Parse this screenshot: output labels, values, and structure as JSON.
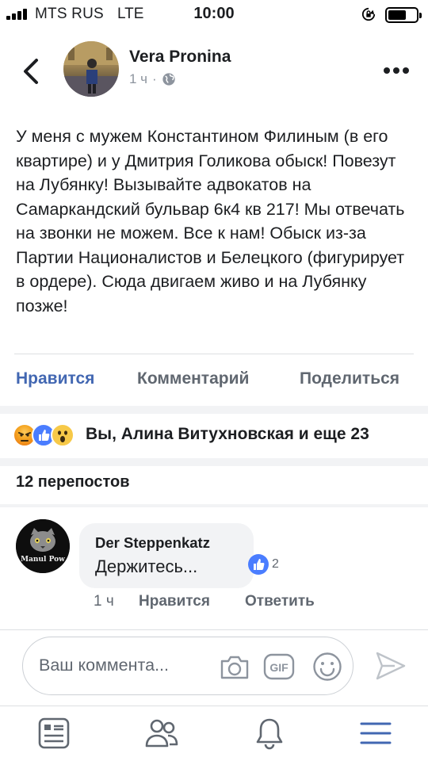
{
  "status_bar": {
    "carrier": "MTS RUS",
    "network": "LTE",
    "time": "10:00"
  },
  "post": {
    "author": "Vera Pronina",
    "time": "1 ч",
    "separator": "·",
    "text": "У меня с мужем Константином Филиным (в его квартире) и у Дмитрия Голикова обыск! Повезут на Лубянку! Вызывайте адвокатов на Самаркандский бульвар 6к4 кв 217! Мы отвечать на звонки не можем. Все к нам! Обыск из-за Партии Националистов и Белецкого (фигурирует в ордере). Сюда двигаем живо и на Лубянку позже!"
  },
  "actions": {
    "like": "Нравится",
    "comment": "Комментарий",
    "share": "Поделиться"
  },
  "reactions": {
    "summary": "Вы, Алина Витухновская и еще 23",
    "icons": [
      "angry-icon",
      "like-icon",
      "wow-icon"
    ]
  },
  "reposts": "12 перепостов",
  "comment": {
    "author": "Der Steppenkatz",
    "text": "Держитесь...",
    "like_count": "2",
    "time": "1 ч",
    "like": "Нравится",
    "reply": "Ответить",
    "avatar_text": "Manul Pow"
  },
  "composer": {
    "placeholder": "Ваш коммента..."
  },
  "colors": {
    "accent": "#4267b2",
    "secondary_text": "#606770",
    "separator": "#f2f3f5"
  }
}
